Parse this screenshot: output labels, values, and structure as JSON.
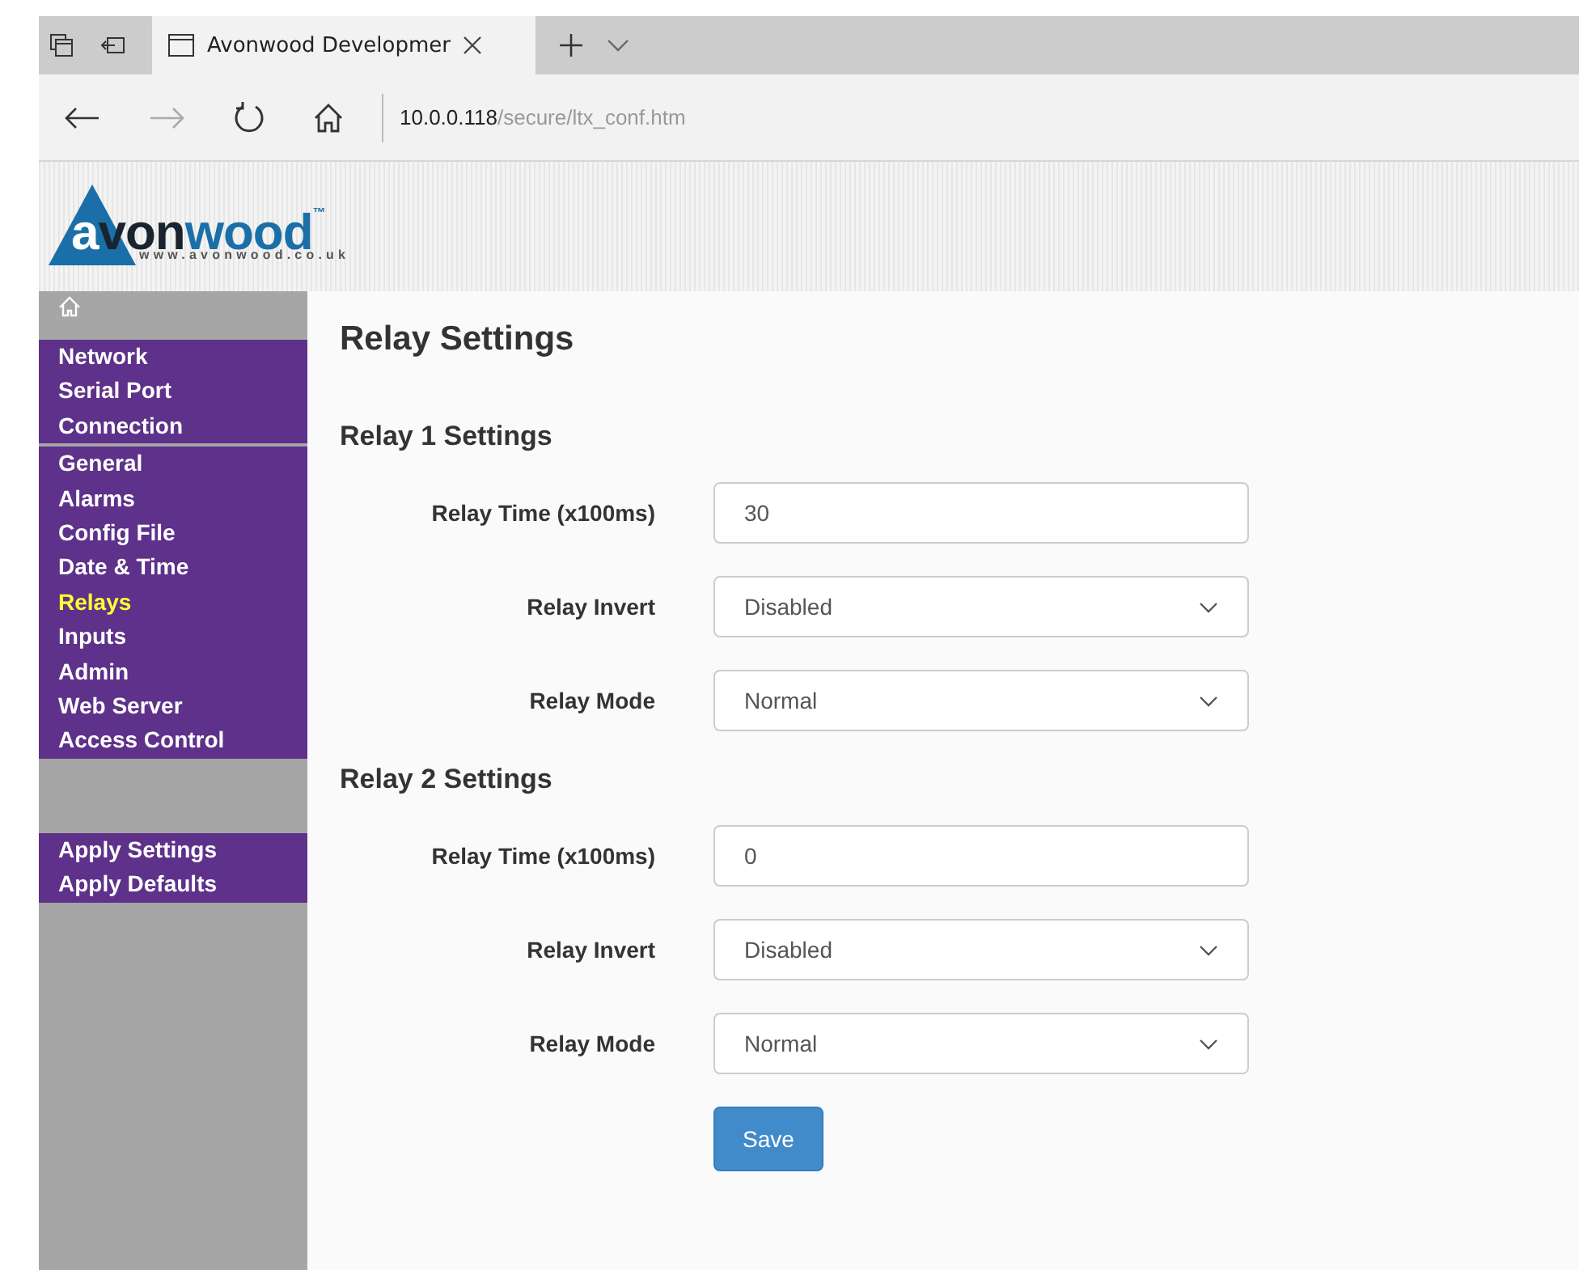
{
  "browser": {
    "tab_title": "Avonwood Developmer",
    "address_host": "10.0.0.118",
    "address_path": "/secure/ltx_conf.htm"
  },
  "header": {
    "wordmark": "avonwood",
    "trademark": "™",
    "website": "www.avonwood.co.uk"
  },
  "sidebar": {
    "groups": [
      {
        "items": [
          {
            "label": "Network",
            "selected": false
          },
          {
            "label": "Serial Port",
            "selected": false
          },
          {
            "label": "Connection",
            "selected": false
          }
        ]
      },
      {
        "items": [
          {
            "label": "General",
            "selected": false
          },
          {
            "label": "Alarms",
            "selected": false
          },
          {
            "label": "Config File",
            "selected": false
          },
          {
            "label": "Date & Time",
            "selected": false
          },
          {
            "label": "Relays",
            "selected": true
          },
          {
            "label": "Inputs",
            "selected": false
          },
          {
            "label": "Admin",
            "selected": false
          },
          {
            "label": "Web Server",
            "selected": false
          },
          {
            "label": "Access Control",
            "selected": false
          }
        ]
      },
      {
        "items": [
          {
            "label": "Apply Settings",
            "selected": false
          },
          {
            "label": "Apply Defaults",
            "selected": false
          }
        ]
      }
    ]
  },
  "page": {
    "title": "Relay Settings",
    "sections": [
      {
        "title": "Relay 1 Settings",
        "fields": [
          {
            "kind": "text",
            "label": "Relay Time (x100ms)",
            "value": "30"
          },
          {
            "kind": "select",
            "label": "Relay Invert",
            "value": "Disabled"
          },
          {
            "kind": "select",
            "label": "Relay Mode",
            "value": "Normal"
          }
        ]
      },
      {
        "title": "Relay 2 Settings",
        "fields": [
          {
            "kind": "text",
            "label": "Relay Time (x100ms)",
            "value": "0"
          },
          {
            "kind": "select",
            "label": "Relay Invert",
            "value": "Disabled"
          },
          {
            "kind": "select",
            "label": "Relay Mode",
            "value": "Normal"
          }
        ]
      }
    ],
    "save_button": "Save"
  }
}
